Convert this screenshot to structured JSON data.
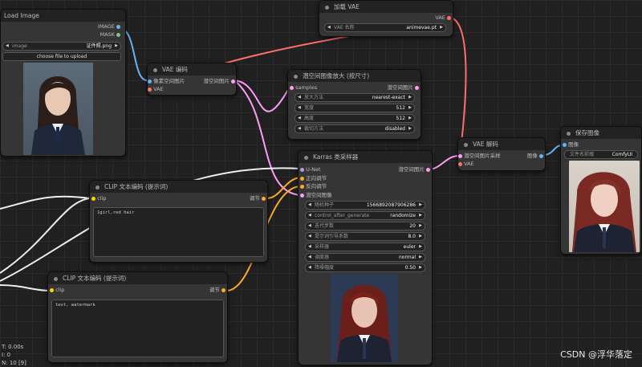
{
  "colors": {
    "image": "#64b5f6",
    "mask": "#81c784",
    "vae": "#ff6e6e",
    "latent": "#ff9cf9",
    "clip": "#ffd500",
    "conditioning": "#ffa931",
    "model": "#b39ddb"
  },
  "load_image": {
    "title": "Load Image",
    "out_image": "IMAGE",
    "out_mask": "MASK",
    "image_label": "image",
    "image_value": "证件照.png",
    "upload_label": "choose file to upload"
  },
  "vae_encode": {
    "title": "VAE 编码",
    "in_pixels": "像素空间图片",
    "in_vae": "VAE",
    "out_latent": "潜空间图片"
  },
  "load_vae": {
    "title": "加载 VAE",
    "out_vae": "VAE",
    "vae_label": "VAE 名称",
    "vae_value": "animevae.pt"
  },
  "upscale": {
    "title": "潜空间图像放大 (按尺寸)",
    "in_samples": "samples",
    "out_latent": "潜空间图片",
    "widgets": [
      {
        "label": "放大方法",
        "value": "nearest-exact"
      },
      {
        "label": "宽度",
        "value": "512"
      },
      {
        "label": "高度",
        "value": "512"
      },
      {
        "label": "裁切方法",
        "value": "disabled"
      }
    ]
  },
  "ksampler": {
    "title": "Karras 类采样器",
    "in_model": "U-Net",
    "in_positive": "正向调节",
    "in_negative": "反向调节",
    "in_latent": "潜空间图像",
    "out_latent": "潜空间图片",
    "widgets": [
      {
        "label": "随机种子",
        "value": "1566892087906286"
      },
      {
        "label": "control_after_generate",
        "value": "randomize"
      },
      {
        "label": "迭代步数",
        "value": "20"
      },
      {
        "label": "提示词引导系数",
        "value": "8.0"
      },
      {
        "label": "采样器",
        "value": "euler"
      },
      {
        "label": "调度器",
        "value": "normal"
      },
      {
        "label": "降噪幅度",
        "value": "0.50"
      }
    ]
  },
  "clip_pos": {
    "title": "CLIP 文本编码 (提示词)",
    "in_clip": "clip",
    "out_cond": "调节",
    "text": "1girl,red hair"
  },
  "clip_neg": {
    "title": "CLIP 文本编码 (提示词)",
    "in_clip": "clip",
    "out_cond": "调节",
    "text": "text, watermark"
  },
  "vae_decode": {
    "title": "VAE 解码",
    "in_latent": "潜空间图片采样",
    "in_vae": "VAE",
    "out_image": "图像"
  },
  "save_image": {
    "title": "保存图像",
    "in_image": "图像",
    "prefix_label": "文件名前缀",
    "prefix_value": "ComfyUI"
  },
  "stats": {
    "t": "T: 0.00s",
    "i": "I: 0",
    "n": "N: 10 [9]"
  },
  "watermark": "CSDN @浮华落定"
}
